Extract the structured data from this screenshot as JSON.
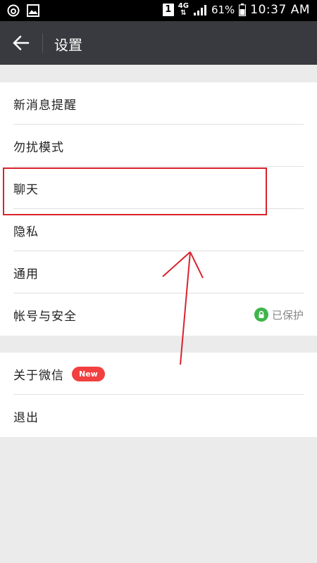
{
  "status_bar": {
    "sim_slot": "1",
    "network_type": "4G",
    "battery": "61%",
    "time": "10:37 AM",
    "left_icons": [
      "netease-music-icon",
      "gallery-icon"
    ]
  },
  "app_bar": {
    "title": "设置"
  },
  "settings": {
    "group1": [
      {
        "label": "新消息提醒"
      },
      {
        "label": "勿扰模式"
      },
      {
        "label": "聊天"
      },
      {
        "label": "隐私"
      },
      {
        "label": "通用"
      },
      {
        "label": "帐号与安全",
        "status": "已保护"
      }
    ],
    "group2": [
      {
        "label": "关于微信",
        "badge": "New"
      },
      {
        "label": "退出"
      }
    ]
  },
  "colors": {
    "app_bar": "#393a3f",
    "page_background": "#ebebeb",
    "badge": "#f23f3f",
    "protect_icon": "#3eb54b",
    "annotation": "#d9232d"
  }
}
